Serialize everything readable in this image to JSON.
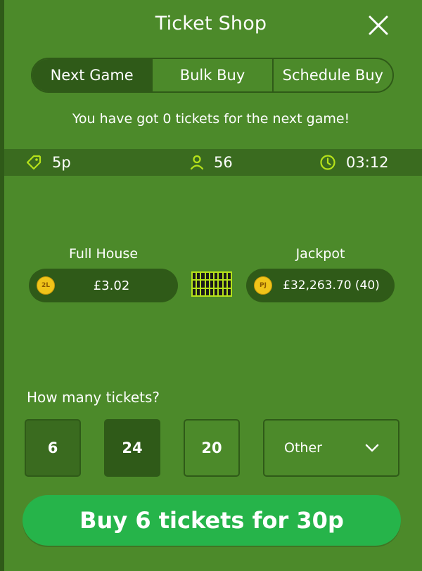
{
  "header": {
    "title": "Ticket Shop",
    "close_icon": "close-icon"
  },
  "tabs": [
    {
      "label": "Next Game",
      "active": true
    },
    {
      "label": "Bulk Buy",
      "active": false
    },
    {
      "label": "Schedule Buy",
      "active": false
    }
  ],
  "notice": "You have got 0 tickets for the next game!",
  "info": {
    "price": "5p",
    "price_icon": "price-tag-icon",
    "players": "56",
    "players_icon": "user-icon",
    "timer": "03:12",
    "timer_icon": "clock-icon"
  },
  "prizes": {
    "full_house": {
      "label": "Full House",
      "coin": "2L",
      "value": "£3.02"
    },
    "jackpot": {
      "label": "Jackpot",
      "coin": "PJ",
      "value": "£32,263.70 (40)"
    },
    "grid_icon": "bingo-ticket-grid-icon"
  },
  "quantity": {
    "prompt": "How many tickets?",
    "options": [
      "6",
      "24",
      "20"
    ],
    "selected": "6",
    "other_label": "Other",
    "other_icon": "chevron-down-icon"
  },
  "buy_button": "Buy 6 tickets for 30p",
  "colors": {
    "panel": "#4c8a2a",
    "dark": "#2f5a18",
    "bar": "#3a6b1f",
    "accent": "#b6e21a",
    "buy": "#26b44a",
    "coin": "#f0c419"
  }
}
